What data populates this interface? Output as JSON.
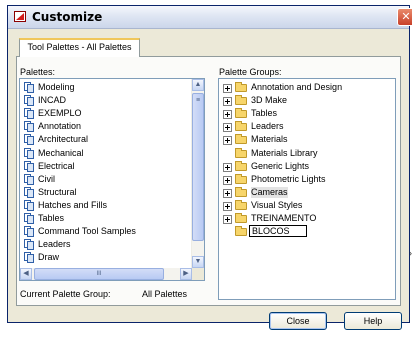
{
  "window": {
    "title": "Customize",
    "close_glyph": "✕"
  },
  "tab": {
    "label": "Tool Palettes - All Palettes"
  },
  "palettes": {
    "label": "Palettes:",
    "items": [
      "Modeling",
      "INCAD",
      "EXEMPLO",
      "Annotation",
      "Architectural",
      "Mechanical",
      "Electrical",
      "Civil",
      "Structural",
      "Hatches and Fills",
      "Tables",
      "Command Tool Samples",
      "Leaders",
      "Draw"
    ],
    "scroll_thumb_glyph": "≡",
    "hscroll_thumb_glyph": "III"
  },
  "palette_groups": {
    "label": "Palette Groups:",
    "items": [
      {
        "name": "Annotation and Design",
        "expandable": true
      },
      {
        "name": "3D Make",
        "expandable": true
      },
      {
        "name": "Tables",
        "expandable": true
      },
      {
        "name": "Leaders",
        "expandable": true
      },
      {
        "name": "Materials",
        "expandable": true
      },
      {
        "name": "Materials Library",
        "expandable": false
      },
      {
        "name": "Generic Lights",
        "expandable": true
      },
      {
        "name": "Photometric Lights",
        "expandable": true
      },
      {
        "name": "Cameras",
        "expandable": true,
        "selected": true
      },
      {
        "name": "Visual Styles",
        "expandable": true
      },
      {
        "name": "TREINAMENTO",
        "expandable": true
      },
      {
        "name": "BLOCOS",
        "expandable": false,
        "editing": true
      }
    ]
  },
  "current_group": {
    "label": "Current Palette Group:",
    "value": "All Palettes"
  },
  "buttons": {
    "close": "Close",
    "help": "Help"
  },
  "colors": {
    "title_bar": "#dfe6f3",
    "dialog_bg": "#ece9d8",
    "selection": "#e3e3e3"
  },
  "icons": {
    "app": "autocad-icon",
    "palette": "palette-icon",
    "folder": "folder-icon"
  }
}
